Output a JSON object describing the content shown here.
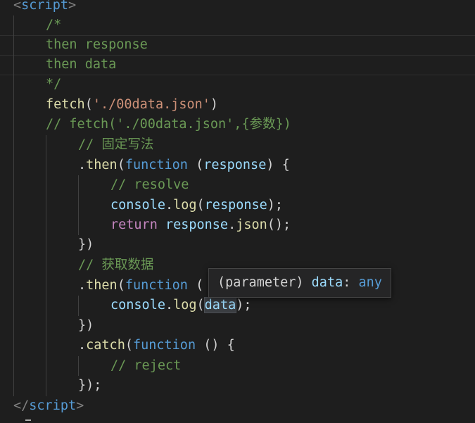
{
  "editor": {
    "lines": [
      {
        "tokens": [
          {
            "t": "<",
            "c": "tag-bracket"
          },
          {
            "t": "script",
            "c": "tag"
          },
          {
            "t": ">",
            "c": "tag-bracket"
          }
        ]
      },
      {
        "tokens": [
          {
            "t": "/*",
            "c": "comment"
          }
        ]
      },
      {
        "tokens": [
          {
            "t": "then response",
            "c": "comment"
          }
        ]
      },
      {
        "tokens": [
          {
            "t": "then data",
            "c": "comment"
          }
        ]
      },
      {
        "tokens": [
          {
            "t": "*/",
            "c": "comment"
          }
        ]
      },
      {
        "tokens": [
          {
            "t": "fetch",
            "c": "fn"
          },
          {
            "t": "(",
            "c": "punc"
          },
          {
            "t": "'./00data.json'",
            "c": "str"
          },
          {
            "t": ")",
            "c": "punc"
          }
        ]
      },
      {
        "tokens": [
          {
            "t": "// fetch('./00data.json',{参数})",
            "c": "comment"
          }
        ]
      },
      {
        "tokens": [
          {
            "t": "// 固定写法",
            "c": "comment"
          }
        ]
      },
      {
        "tokens": [
          {
            "t": ".",
            "c": "punc"
          },
          {
            "t": "then",
            "c": "fn"
          },
          {
            "t": "(",
            "c": "punc"
          },
          {
            "t": "function",
            "c": "kw"
          },
          {
            "t": " (",
            "c": "punc"
          },
          {
            "t": "response",
            "c": "var"
          },
          {
            "t": ") {",
            "c": "punc"
          }
        ]
      },
      {
        "tokens": [
          {
            "t": "// resolve",
            "c": "comment"
          }
        ]
      },
      {
        "tokens": [
          {
            "t": "console",
            "c": "var"
          },
          {
            "t": ".",
            "c": "punc"
          },
          {
            "t": "log",
            "c": "fn"
          },
          {
            "t": "(",
            "c": "punc"
          },
          {
            "t": "response",
            "c": "var"
          },
          {
            "t": ");",
            "c": "punc"
          }
        ]
      },
      {
        "tokens": [
          {
            "t": "return",
            "c": "ctl"
          },
          {
            "t": " ",
            "c": "punc"
          },
          {
            "t": "response",
            "c": "var"
          },
          {
            "t": ".",
            "c": "punc"
          },
          {
            "t": "json",
            "c": "fn"
          },
          {
            "t": "();",
            "c": "punc"
          }
        ]
      },
      {
        "tokens": [
          {
            "t": "})",
            "c": "punc"
          }
        ]
      },
      {
        "tokens": [
          {
            "t": "// 获取数据",
            "c": "comment"
          }
        ]
      },
      {
        "tokens": [
          {
            "t": ".",
            "c": "punc"
          },
          {
            "t": "then",
            "c": "fn"
          },
          {
            "t": "(",
            "c": "punc"
          },
          {
            "t": "function",
            "c": "kw"
          },
          {
            "t": " (",
            "c": "punc"
          }
        ]
      },
      {
        "tokens": [
          {
            "t": "console",
            "c": "var"
          },
          {
            "t": ".",
            "c": "punc"
          },
          {
            "t": "log",
            "c": "fn"
          },
          {
            "t": "(",
            "c": "punc"
          },
          {
            "t": "data",
            "c": "var",
            "hl": true
          },
          {
            "t": ");",
            "c": "punc"
          }
        ]
      },
      {
        "tokens": [
          {
            "t": "})",
            "c": "punc"
          }
        ]
      },
      {
        "tokens": [
          {
            "t": ".",
            "c": "punc"
          },
          {
            "t": "catch",
            "c": "fn"
          },
          {
            "t": "(",
            "c": "punc"
          },
          {
            "t": "function",
            "c": "kw"
          },
          {
            "t": " () {",
            "c": "punc"
          }
        ]
      },
      {
        "tokens": [
          {
            "t": "// reject",
            "c": "comment"
          }
        ]
      },
      {
        "tokens": [
          {
            "t": "});",
            "c": "punc"
          }
        ]
      },
      {
        "tokens": [
          {
            "t": "</",
            "c": "tag-bracket"
          },
          {
            "t": "script",
            "c": "tag"
          },
          {
            "t": ">",
            "c": "tag-bracket"
          }
        ]
      }
    ]
  },
  "hover": {
    "tokens": [
      {
        "t": "(parameter)",
        "c": "punc"
      },
      {
        "t": " ",
        "c": "punc"
      },
      {
        "t": "data",
        "c": "var"
      },
      {
        "t": ": ",
        "c": "punc"
      },
      {
        "t": "any",
        "c": "kw"
      }
    ]
  }
}
